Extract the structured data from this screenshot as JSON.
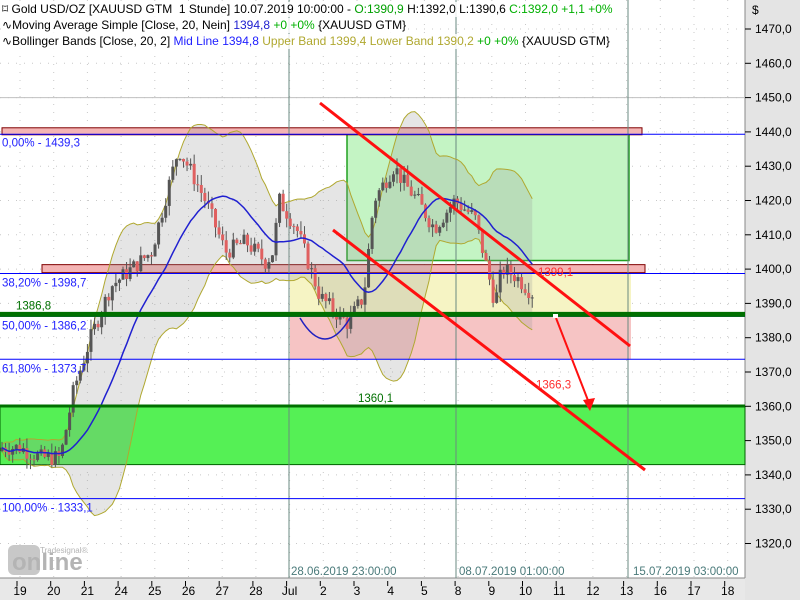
{
  "legend": {
    "line1": {
      "name": "Gold USD/OZ [XAUUSD GTM  1 Stunde] 10.07.2019 10:00:00 - ",
      "o": "O:1390,9",
      "h": "H:1392,0",
      "l": "L:1390,6",
      "c": "C:1392,0 +1,1 +0%"
    },
    "line2": {
      "name": "Moving Average Simple [Close, 20, Nein]",
      "value": "1394,8",
      "chg": "+0 +0%",
      "sym": "{XAUUSD GTM}"
    },
    "line3": {
      "name": "Bollinger Bands [Close, 20, 2]",
      "mid": "Mid Line 1394,8",
      "upper": "Upper Band 1399,4",
      "lower": "Lower Band 1390,2",
      "chg": "+0 +0%",
      "sym": "{XAUUSD GTM}"
    }
  },
  "annotations": {
    "fib0": "0,00% - 1439,3",
    "fib382": "38,20% - 1398,7",
    "fib50": "50,00% - 1386,2",
    "fib618": "61,80% - 1373,7",
    "fib100": "100,00% - 1333,1",
    "level_1386": "1386,8",
    "level_1399": "1399,1",
    "level_1366": "1366,3",
    "level_1360": "1360,1",
    "date1": "28.06.2019 23:00:00",
    "date2": "08.07.2019 01:00:00",
    "date3": "15.07.2019 03:00:00"
  },
  "logo": {
    "top": "Tradesignal®",
    "main": "online"
  },
  "colors": {
    "up": "#555555",
    "down": "#e06060",
    "ma": "#2020d0",
    "band": "#b0a830",
    "fib": "#0000ff",
    "green": "#007000",
    "red": "#ff1010"
  },
  "chart_data": {
    "type": "candlestick",
    "title": "Gold USD/OZ [XAUUSD GTM 1 Stunde]",
    "currency_label": "$",
    "ylim": [
      1313,
      1478
    ],
    "y_ticks": [
      "1320,0",
      "1330,0",
      "1340,0",
      "1350,0",
      "1360,0",
      "1370,0",
      "1380,0",
      "1390,0",
      "1400,0",
      "1410,0",
      "1420,0",
      "1430,0",
      "1440,0",
      "1450,0",
      "1460,0",
      "1470,0"
    ],
    "x_ticks": [
      "19",
      "20",
      "21",
      "24",
      "25",
      "26",
      "27",
      "28",
      "Jul",
      "2",
      "3",
      "4",
      "5",
      "8",
      "9",
      "10",
      "11",
      "12",
      "13",
      "16",
      "17",
      "18"
    ],
    "price_path_day_index": [
      0,
      0.6,
      1.2,
      1.6,
      2.1,
      2.7,
      3.3,
      3.9,
      4.3,
      4.7,
      5.1,
      5.5,
      6.1,
      6.7,
      7.3,
      7.5,
      7.7,
      8.2,
      8.45,
      8.9,
      9.3,
      9.75,
      9.95,
      10.2,
      10.5,
      11.1,
      11.4,
      11.8,
      12.1,
      12.3,
      12.9,
      13.5,
      14.1,
      14.3,
      14.7,
      15.2
    ],
    "price_path_close": [
      1348,
      1345,
      1345,
      1365,
      1380,
      1395,
      1400,
      1405,
      1420,
      1435,
      1428,
      1420,
      1405,
      1408,
      1402,
      1405,
      1420,
      1412,
      1405,
      1392,
      1388,
      1384,
      1388,
      1392,
      1420,
      1430,
      1425,
      1420,
      1415,
      1412,
      1420,
      1415,
      1390,
      1400,
      1398,
      1393
    ],
    "last": {
      "open": 1390.9,
      "high": 1392.0,
      "low": 1390.6,
      "close": 1392.0
    },
    "indicators": {
      "sma20": 1394.8,
      "bb_upper": 1399.4,
      "bb_lower": 1390.2
    },
    "fibonacci": [
      {
        "pct": 0,
        "value": 1439.3
      },
      {
        "pct": 38.2,
        "value": 1398.7
      },
      {
        "pct": 50,
        "value": 1386.2
      },
      {
        "pct": 61.8,
        "value": 1373.7
      },
      {
        "pct": 100,
        "value": 1333.1
      }
    ],
    "levels": [
      1399.1,
      1386.8,
      1366.3,
      1360.1
    ]
  }
}
